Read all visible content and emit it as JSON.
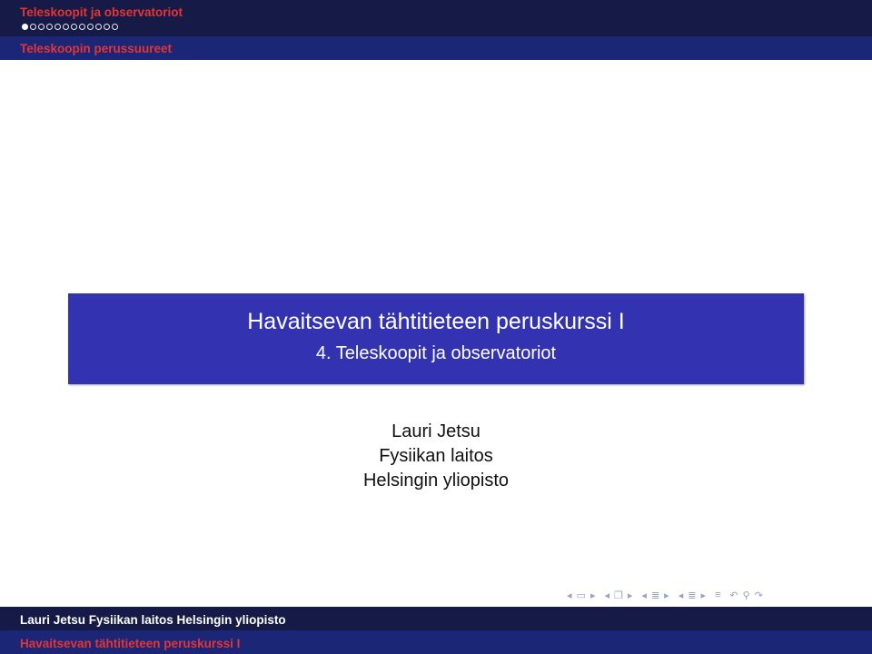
{
  "header": {
    "section_title": "Teleskoopit ja observatoriot",
    "subsection_title": "Teleskoopin perussuureet",
    "progress": {
      "total_frames": 12,
      "current_frame": 1
    }
  },
  "title_slide": {
    "title": "Havaitsevan tähtitieteen peruskurssi I",
    "subtitle": "4. Teleskoopit ja observatoriot",
    "author": "Lauri Jetsu",
    "department": "Fysiikan laitos",
    "university": "Helsingin yliopisto"
  },
  "navigation": {
    "icons": [
      "arrow-left-icon",
      "frame-icon",
      "arrow-right-icon",
      "arrow-left-icon",
      "subsection-icon",
      "arrow-right-icon",
      "arrow-left-icon",
      "section-icon",
      "arrow-right-icon",
      "arrow-left-icon",
      "presentation-icon",
      "arrow-right-icon",
      "align-icon",
      "search-back-icon",
      "search-icon",
      "search-forward-icon"
    ]
  },
  "footer": {
    "author_line": "Lauri Jetsu  Fysiikan laitos  Helsingin yliopisto",
    "title_line": "Havaitsevan tähtitieteen peruskurssi I"
  },
  "colors": {
    "header_dark": "#161a47",
    "header_mid": "#1b2676",
    "title_box": "#3333b2",
    "accent_red": "#e63434"
  }
}
